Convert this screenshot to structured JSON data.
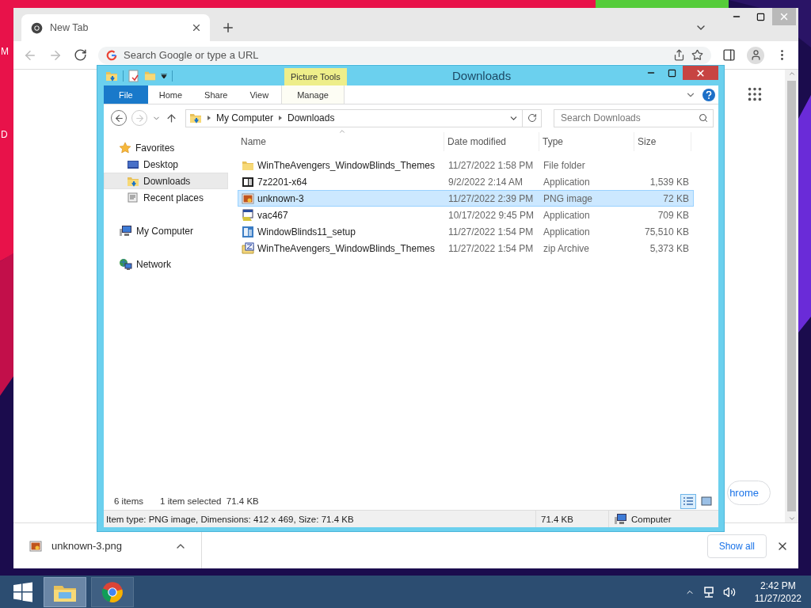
{
  "desktop": {
    "icon_labels": [
      "M",
      "D"
    ]
  },
  "browser": {
    "tabs": [
      {
        "label": "New Tab",
        "selected": true
      }
    ],
    "omnibox": {
      "placeholder": "Search Google or type a URL"
    },
    "customize_button": {
      "label": "hrome"
    },
    "download_bar": {
      "items": [
        {
          "name": "unknown-3.png"
        }
      ],
      "show_all": "Show all"
    }
  },
  "explorer": {
    "title": "Downloads",
    "context_group": "Picture Tools",
    "ribbon_tabs": [
      {
        "label": "File",
        "kind": "file"
      },
      {
        "label": "Home",
        "kind": "tab"
      },
      {
        "label": "Share",
        "kind": "tab"
      },
      {
        "label": "View",
        "kind": "tab"
      },
      {
        "label": "Manage",
        "kind": "context"
      }
    ],
    "breadcrumb": [
      "My Computer",
      "Downloads"
    ],
    "search": {
      "placeholder": "Search Downloads"
    },
    "nav": [
      {
        "label": "Favorites",
        "kind": "star",
        "selected": false,
        "children": [
          {
            "label": "Desktop",
            "kind": "desktop",
            "selected": false
          },
          {
            "label": "Downloads",
            "kind": "downloads",
            "selected": true
          },
          {
            "label": "Recent places",
            "kind": "recent",
            "selected": false
          }
        ]
      },
      {
        "label": "My Computer",
        "kind": "computer",
        "selected": false
      },
      {
        "label": "Network",
        "kind": "network",
        "selected": false
      }
    ],
    "columns": [
      "Name",
      "Date modified",
      "Type",
      "Size"
    ],
    "files": [
      {
        "name": "WinTheAvengers_WindowBlinds_Themes",
        "date": "11/27/2022 1:58 PM",
        "type": "File folder",
        "kind": "folder",
        "selected": false
      },
      {
        "name": "7z2201-x64",
        "date": "9/2/2022 2:14 AM",
        "type": "Application",
        "size": "1,539 KB",
        "kind": "sevenzip",
        "selected": false
      },
      {
        "name": "unknown-3",
        "date": "11/27/2022 2:39 PM",
        "type": "PNG image",
        "size": "72 KB",
        "kind": "image",
        "selected": true
      },
      {
        "name": "vac467",
        "date": "10/17/2022 9:45 PM",
        "type": "Application",
        "size": "709 KB",
        "kind": "app",
        "selected": false
      },
      {
        "name": "WindowBlinds11_setup",
        "date": "11/27/2022 1:54 PM",
        "type": "Application",
        "size": "75,510 KB",
        "kind": "setup",
        "selected": false
      },
      {
        "name": "WinTheAvengers_WindowBlinds_Themes",
        "date": "11/27/2022 1:54 PM",
        "type": "zip Archive",
        "size": "5,373 KB",
        "kind": "zip",
        "selected": false
      }
    ],
    "status": {
      "count": "6 items",
      "selection": "1 item selected  71.4 KB",
      "views": [
        {
          "kind": "details",
          "selected": true
        },
        {
          "kind": "large",
          "selected": false
        }
      ]
    },
    "details_bar": {
      "info": "Item type: PNG image, Dimensions: 412 x 469, Size: 71.4 KB",
      "size": "71.4 KB",
      "location": "Computer"
    }
  },
  "taskbar": {
    "apps": [
      {
        "kind": "explorer",
        "selected": true
      },
      {
        "kind": "chrome",
        "selected": false
      }
    ],
    "clock": {
      "time": "2:42 PM",
      "date": "11/27/2022"
    }
  }
}
